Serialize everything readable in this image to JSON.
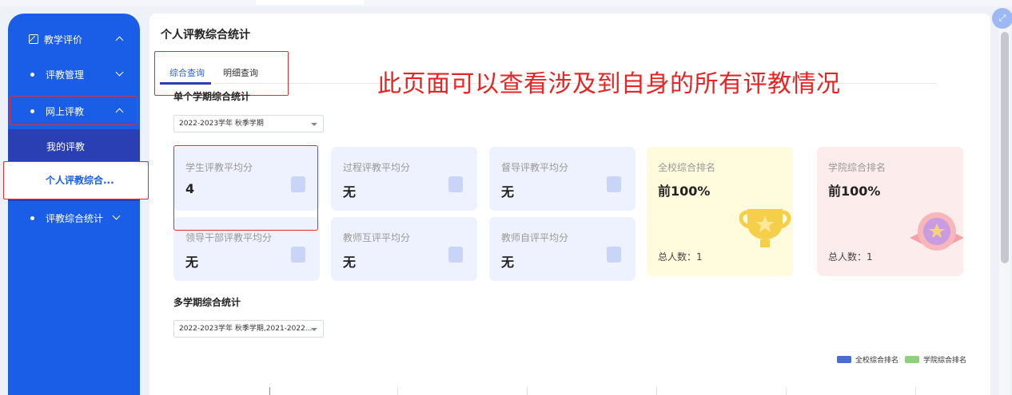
{
  "sidebar": {
    "top_label": "教学评价",
    "items": [
      {
        "label": "评教管理"
      },
      {
        "label": "网上评教"
      },
      {
        "label": "我的评教"
      },
      {
        "label": "个人评教综合..."
      },
      {
        "label": "评教综合统计"
      }
    ]
  },
  "page": {
    "title": "个人评教综合统计",
    "tabs": [
      {
        "label": "综合查询",
        "active": true
      },
      {
        "label": "明细查询",
        "active": false
      }
    ],
    "annotation": "此页面可以查看涉及到自身的所有评教情况"
  },
  "single": {
    "section_title": "单个学期综合统计",
    "select_value": "2022-2023学年 秋季学期",
    "cards": [
      {
        "label": "学生评教平均分",
        "value": "4",
        "icon": "graduate-icon"
      },
      {
        "label": "过程评教平均分",
        "value": "无",
        "icon": "document-edit-icon"
      },
      {
        "label": "督导评教平均分",
        "value": "无",
        "icon": "clipboard-icon"
      },
      {
        "label": "领导干部评教平均分",
        "value": "无",
        "icon": "person-icon"
      },
      {
        "label": "教师互评平均分",
        "value": "无",
        "icon": "chat-icon"
      },
      {
        "label": "教师自评平均分",
        "value": "无",
        "icon": "pencil-icon"
      }
    ],
    "school_rank": {
      "label": "全校综合排名",
      "value": "前100%",
      "total": "总人数：1"
    },
    "college_rank": {
      "label": "学院综合排名",
      "value": "前100%",
      "total": "总人数：1"
    }
  },
  "multi": {
    "section_title": "多学期综合统计",
    "select_value": "2022-2023学年 秋季学期,2021-2022...",
    "legend": [
      {
        "name": "全校综合排名",
        "color": "#4a6bcf"
      },
      {
        "name": "学院综合排名",
        "color": "#8ed07e"
      }
    ]
  }
}
